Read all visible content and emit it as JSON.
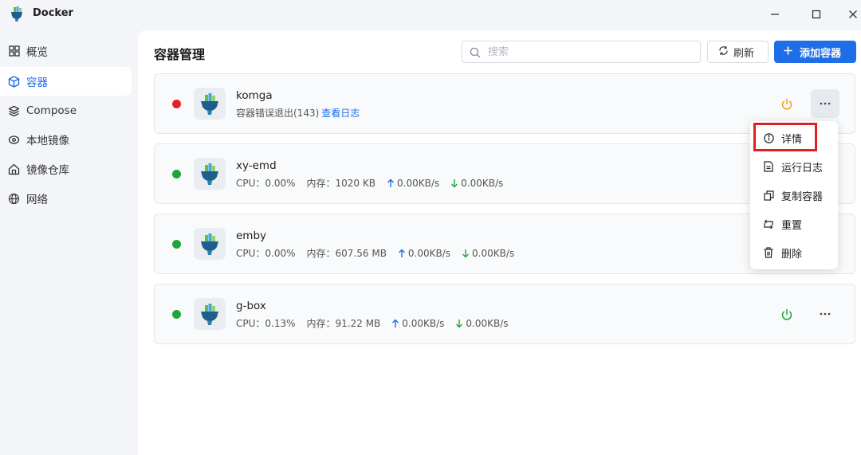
{
  "window": {
    "title": "Docker"
  },
  "sidebar": {
    "items": [
      {
        "label": "概览",
        "icon": "grid-icon",
        "active": false
      },
      {
        "label": "容器",
        "icon": "cube-icon",
        "active": true
      },
      {
        "label": "Compose",
        "icon": "layers-icon",
        "active": false
      },
      {
        "label": "本地镜像",
        "icon": "disk-icon",
        "active": false
      },
      {
        "label": "镜像仓库",
        "icon": "home-icon",
        "active": false
      },
      {
        "label": "网络",
        "icon": "globe-icon",
        "active": false
      }
    ]
  },
  "main": {
    "title": "容器管理",
    "search_placeholder": "搜索",
    "refresh_label": "刷新",
    "add_label": "添加容器"
  },
  "containers": [
    {
      "name": "komga",
      "status": "error",
      "error_text": "容器错误退出(143)",
      "log_link": "查看日志"
    },
    {
      "name": "xy-emd",
      "status": "running",
      "cpu": "CPU：0.00%",
      "mem": "内存：1020 KB",
      "up": "0.00KB/s",
      "down": "0.00KB/s"
    },
    {
      "name": "emby",
      "status": "running",
      "cpu": "CPU：0.00%",
      "mem": "内存：607.56 MB",
      "up": "0.00KB/s",
      "down": "0.00KB/s"
    },
    {
      "name": "g-box",
      "status": "running",
      "cpu": "CPU：0.13%",
      "mem": "内存：91.22 MB",
      "up": "0.00KB/s",
      "down": "0.00KB/s"
    }
  ],
  "context_menu": {
    "items": [
      {
        "label": "详情",
        "icon": "info-icon"
      },
      {
        "label": "运行日志",
        "icon": "document-icon"
      },
      {
        "label": "复制容器",
        "icon": "copy-icon"
      },
      {
        "label": "重置",
        "icon": "reset-icon"
      },
      {
        "label": "删除",
        "icon": "trash-icon"
      }
    ]
  },
  "colors": {
    "accent": "#1e6ee8",
    "running": "#1fa637",
    "error": "#e8202a",
    "stop_power": "#f0a020",
    "highlight": "#e02020"
  }
}
